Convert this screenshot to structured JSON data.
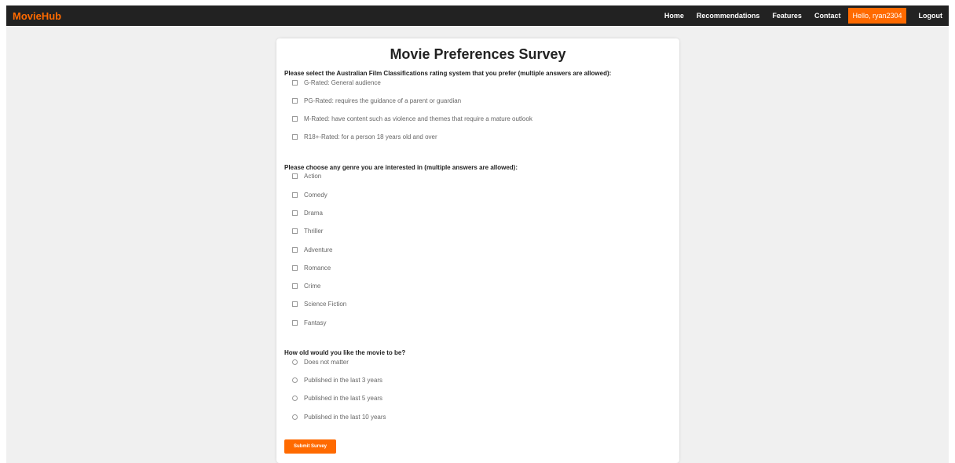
{
  "nav": {
    "brand": "MovieHub",
    "links": [
      "Home",
      "Recommendations",
      "Features",
      "Contact"
    ],
    "user_label": "Hello, ryan2304",
    "logout": "Logout"
  },
  "survey": {
    "title": "Movie Preferences Survey",
    "rating_question": "Please select the Australian Film Classifications rating system that you prefer (multiple answers are allowed):",
    "rating_options": [
      "G-Rated: General audience",
      "PG-Rated: requires the guidance of a parent or guardian",
      "M-Rated: have content such as violence and themes that require a mature outlook",
      "R18+-Rated: for a person 18 years old and over"
    ],
    "genre_question": "Please choose any genre you are interested in (multiple answers are allowed):",
    "genre_options": [
      "Action",
      "Comedy",
      "Drama",
      "Thriller",
      "Adventure",
      "Romance",
      "Crime",
      "Science Fiction",
      "Fantasy"
    ],
    "age_question": "How old would you like the movie to be?",
    "age_options": [
      "Does not matter",
      "Published in the last 3 years",
      "Published in the last 5 years",
      "Published in the last 10 years"
    ],
    "submit_label": "Submit Survey"
  },
  "colors": {
    "accent": "#ff6a00",
    "navbar": "#222222",
    "background": "#f0f0f0"
  }
}
